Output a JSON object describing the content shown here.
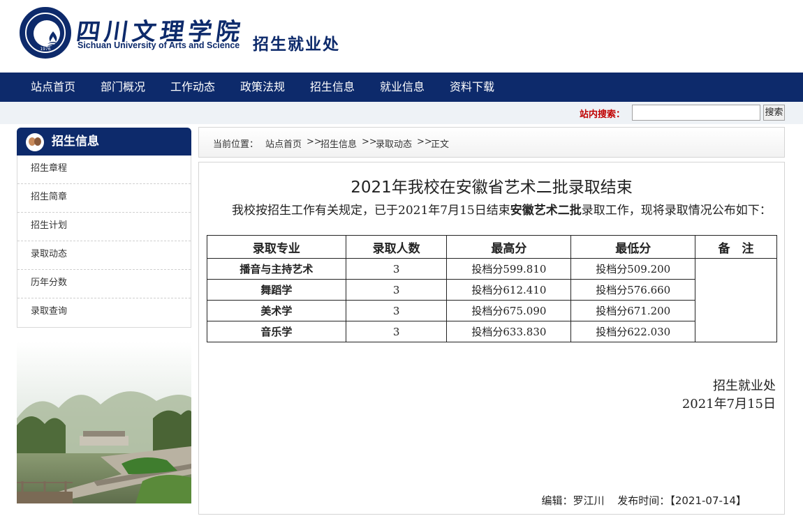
{
  "header": {
    "univ_cn": "四川文理学院",
    "univ_en": "Sichuan University of Arts and Science",
    "dept": "招生就业处",
    "seal_year": "1976"
  },
  "nav": [
    "站点首页",
    "部门概况",
    "工作动态",
    "政策法规",
    "招生信息",
    "就业信息",
    "资料下载"
  ],
  "search": {
    "label": "站内搜索：",
    "value": "",
    "button": "搜索"
  },
  "sidebar": {
    "title": "招生信息",
    "items": [
      "招生章程",
      "招生简章",
      "招生计划",
      "录取动态",
      "历年分数",
      "录取查询"
    ]
  },
  "breadcrumb": {
    "prefix": "当前位置：",
    "items": [
      "站点首页",
      ">>",
      "招生信息",
      ">>",
      "录取动态",
      ">>",
      "正文"
    ]
  },
  "article": {
    "title": "2021年我校在安徽省艺术二批录取结束",
    "para_before": "我校按招生工作有关规定，已于2021年7月15日结束",
    "para_bold": "安徽艺术二批",
    "para_after": "录取工作，现将录取情况公布如下：",
    "table": {
      "headers": [
        "录取专业",
        "录取人数",
        "最高分",
        "最低分",
        "备　注"
      ],
      "rows": [
        {
          "major": "播音与主持艺术",
          "count": "3",
          "max": "投档分599.810",
          "min": "投档分509.200"
        },
        {
          "major": "舞蹈学",
          "count": "3",
          "max": "投档分612.410",
          "min": "投档分576.660"
        },
        {
          "major": "美术学",
          "count": "3",
          "max": "投档分675.090",
          "min": "投档分671.200"
        },
        {
          "major": "音乐学",
          "count": "3",
          "max": "投档分633.830",
          "min": "投档分622.030"
        }
      ],
      "note": ""
    },
    "sign_dept": "招生就业处",
    "sign_date": "2021年7月15日",
    "editor_label": "编辑：",
    "editor": "罗江川",
    "publish_label": "发布时间：",
    "publish_time": "【2021-07-14】"
  }
}
